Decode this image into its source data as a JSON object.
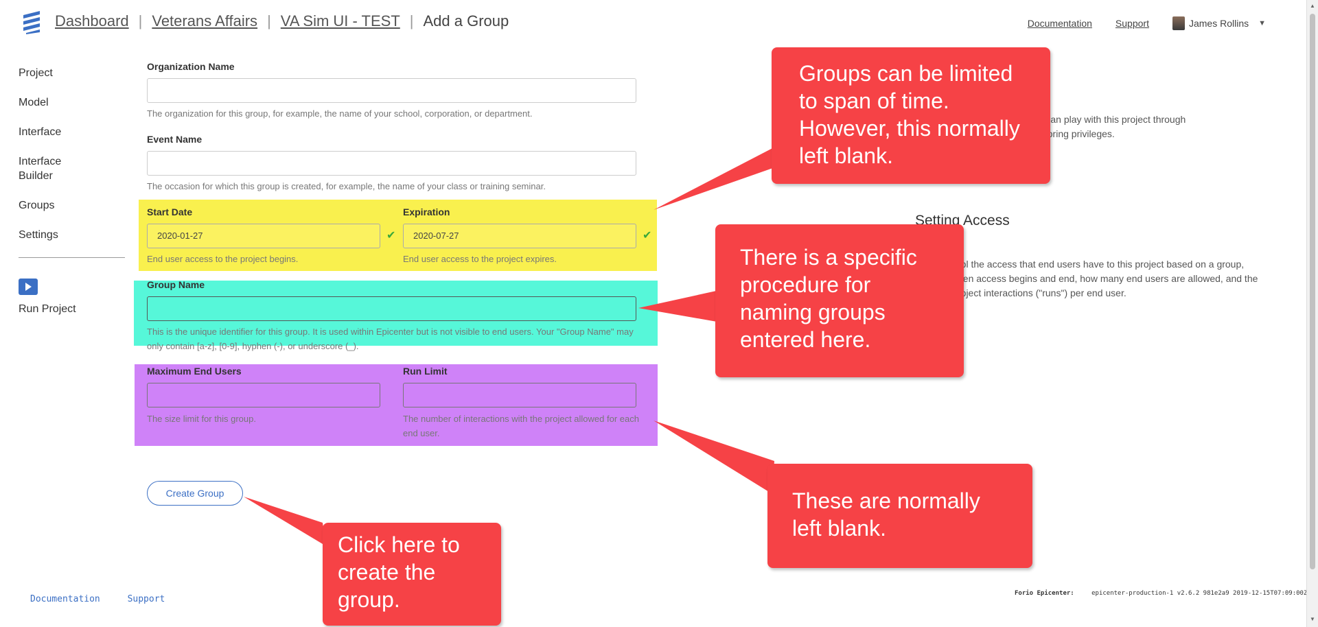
{
  "header": {
    "breadcrumbs": [
      "Dashboard",
      "Veterans Affairs",
      "VA Sim UI - TEST"
    ],
    "current_page": "Add a Group",
    "separator": "|",
    "links": {
      "documentation": "Documentation",
      "support": "Support"
    },
    "user_name": "James Rollins",
    "caret": "▼"
  },
  "sidebar": {
    "items": [
      {
        "label": "Project"
      },
      {
        "label": "Model"
      },
      {
        "label": "Interface"
      },
      {
        "label": "Interface Builder"
      },
      {
        "label": "Groups"
      },
      {
        "label": "Settings"
      }
    ],
    "run_project": "Run Project"
  },
  "form": {
    "org": {
      "label": "Organization Name",
      "value": "",
      "help": "The organization for this group, for example, the name of your school, corporation, or department."
    },
    "event": {
      "label": "Event Name",
      "value": "",
      "help": "The occasion for which this group is created, for example, the name of your class or training seminar."
    },
    "start": {
      "label": "Start Date",
      "value": "2020-01-27",
      "help": "End user access to the project begins."
    },
    "expiration": {
      "label": "Expiration",
      "value": "2020-07-27",
      "help": "End user access to the project expires."
    },
    "group_name": {
      "label": "Group Name",
      "value": "",
      "help": "This is the unique identifier for this group. It is used within Epicenter but is not visible to end users. Your \"Group Name\" may only contain [a-z], [0-9], hyphen (-), or underscore (_)."
    },
    "max_users": {
      "label": "Maximum End Users",
      "value": "",
      "help": "The size limit for this group."
    },
    "run_limit": {
      "label": "Run Limit",
      "value": "",
      "help": "The number of interactions with the project allowed for each end user."
    },
    "check": "✔",
    "submit": "Create Group"
  },
  "info": {
    "para1_line1": "nd users. End users can play with this project through",
    "para1_line2": "not have project authoring privileges.",
    "setting_access_title": "Setting Access",
    "para2_line1": "rol the access that end users have to this project based on a group,",
    "para2_line2": "hen access begins and end, how many end users are allowed, and the",
    "para2_line3": "roject interactions (\"runs\") per end user."
  },
  "callouts": {
    "dates": "Groups can be limited to span of time. However, this normally left blank.",
    "naming": "There is a specific procedure for naming groups entered here.",
    "limits": "These are normally left blank.",
    "create": "Click here to create the group."
  },
  "footer": {
    "documentation": "Documentation",
    "support": "Support",
    "brand": "Forio Epicenter:",
    "version": "epicenter-production-1 v2.6.2 981e2a9 2019-12-15T07:09:00Z"
  },
  "colors": {
    "highlight_dates": "#f9f04e",
    "highlight_group_name": "#56f7d9",
    "highlight_limits": "#cf82f8",
    "callout": "#f64246",
    "accent": "#3b6fc4"
  }
}
